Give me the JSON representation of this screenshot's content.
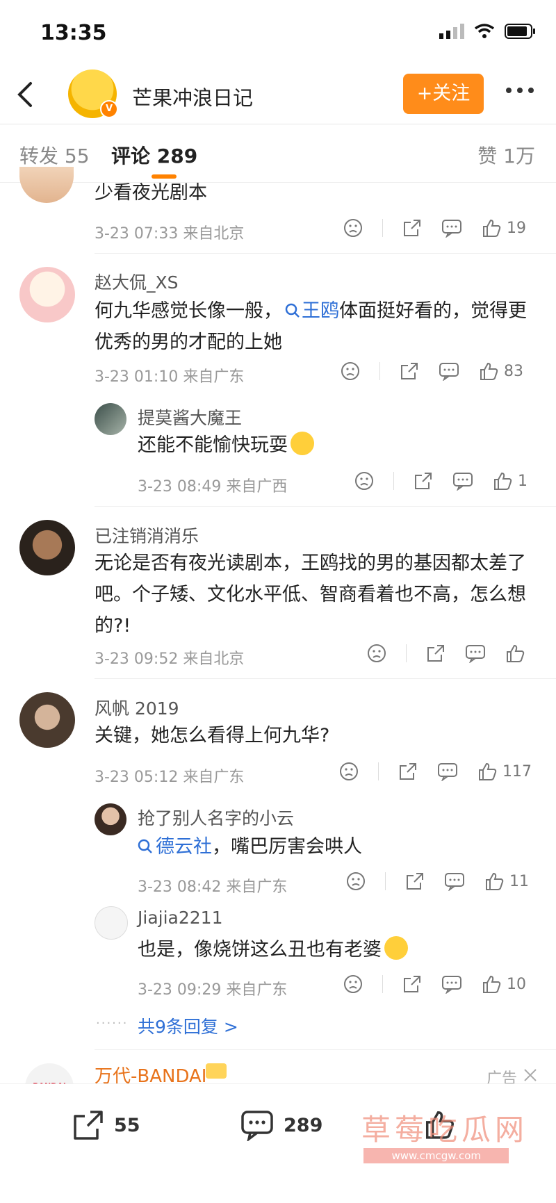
{
  "status_bar": {
    "time": "13:35"
  },
  "header": {
    "title": "芒果冲浪日记",
    "follow_label": "+关注",
    "verified_badge": "V"
  },
  "tabs": {
    "repost": "转发 55",
    "comments": "评论 289",
    "likes": "赞 1万"
  },
  "comments": [
    {
      "id": "c0",
      "text": "少看夜光剧本",
      "meta": "3-23 07:33  来自北京",
      "likes": "19"
    },
    {
      "id": "c1",
      "user": "赵大侃_XS",
      "text_before": "何九华感觉长像一般，",
      "topic": "王鸥",
      "text_after": "体面挺好看的，觉得更优秀的男的才配的上她",
      "meta": "3-23 01:10  来自广东",
      "likes": "83",
      "replies": [
        {
          "user": "提莫酱大魔王",
          "text": "还能不能愉快玩耍",
          "meta": "3-23 08:49  来自广西",
          "likes": "1"
        }
      ]
    },
    {
      "id": "c2",
      "user": "已注销消消乐",
      "text": "无论是否有夜光读剧本，王鸥找的男的基因都太差了吧。个子矮、文化水平低、智商看着也不高，怎么想的?!",
      "meta": "3-23 09:52  来自北京",
      "likes": ""
    },
    {
      "id": "c3",
      "user": "风帆 2019",
      "text": "关键，她怎么看得上何九华?",
      "meta": "3-23 05:12  来自广东",
      "likes": "117",
      "replies": [
        {
          "user": "抢了别人名字的小云",
          "topic": "德云社",
          "text_after": "，嘴巴厉害会哄人",
          "meta": "3-23 08:42  来自广东",
          "likes": "11"
        },
        {
          "user": "Jiajia2211",
          "text": "也是，像烧饼这么丑也有老婆",
          "meta": "3-23 09:29  来自广东",
          "likes": "10"
        }
      ],
      "more_replies": "共9条回复 >"
    }
  ],
  "ad": {
    "name": "万代-BANDAI",
    "label": "广告",
    "logo_text": "BANDAI"
  },
  "bottom_bar": {
    "repost_count": "55",
    "comment_count": "289"
  },
  "watermark": {
    "main": "草莓吃瓜网",
    "sub": "www.cmcgw.com"
  },
  "colors": {
    "accent": "#ff8200",
    "link": "#2e6fd6"
  }
}
